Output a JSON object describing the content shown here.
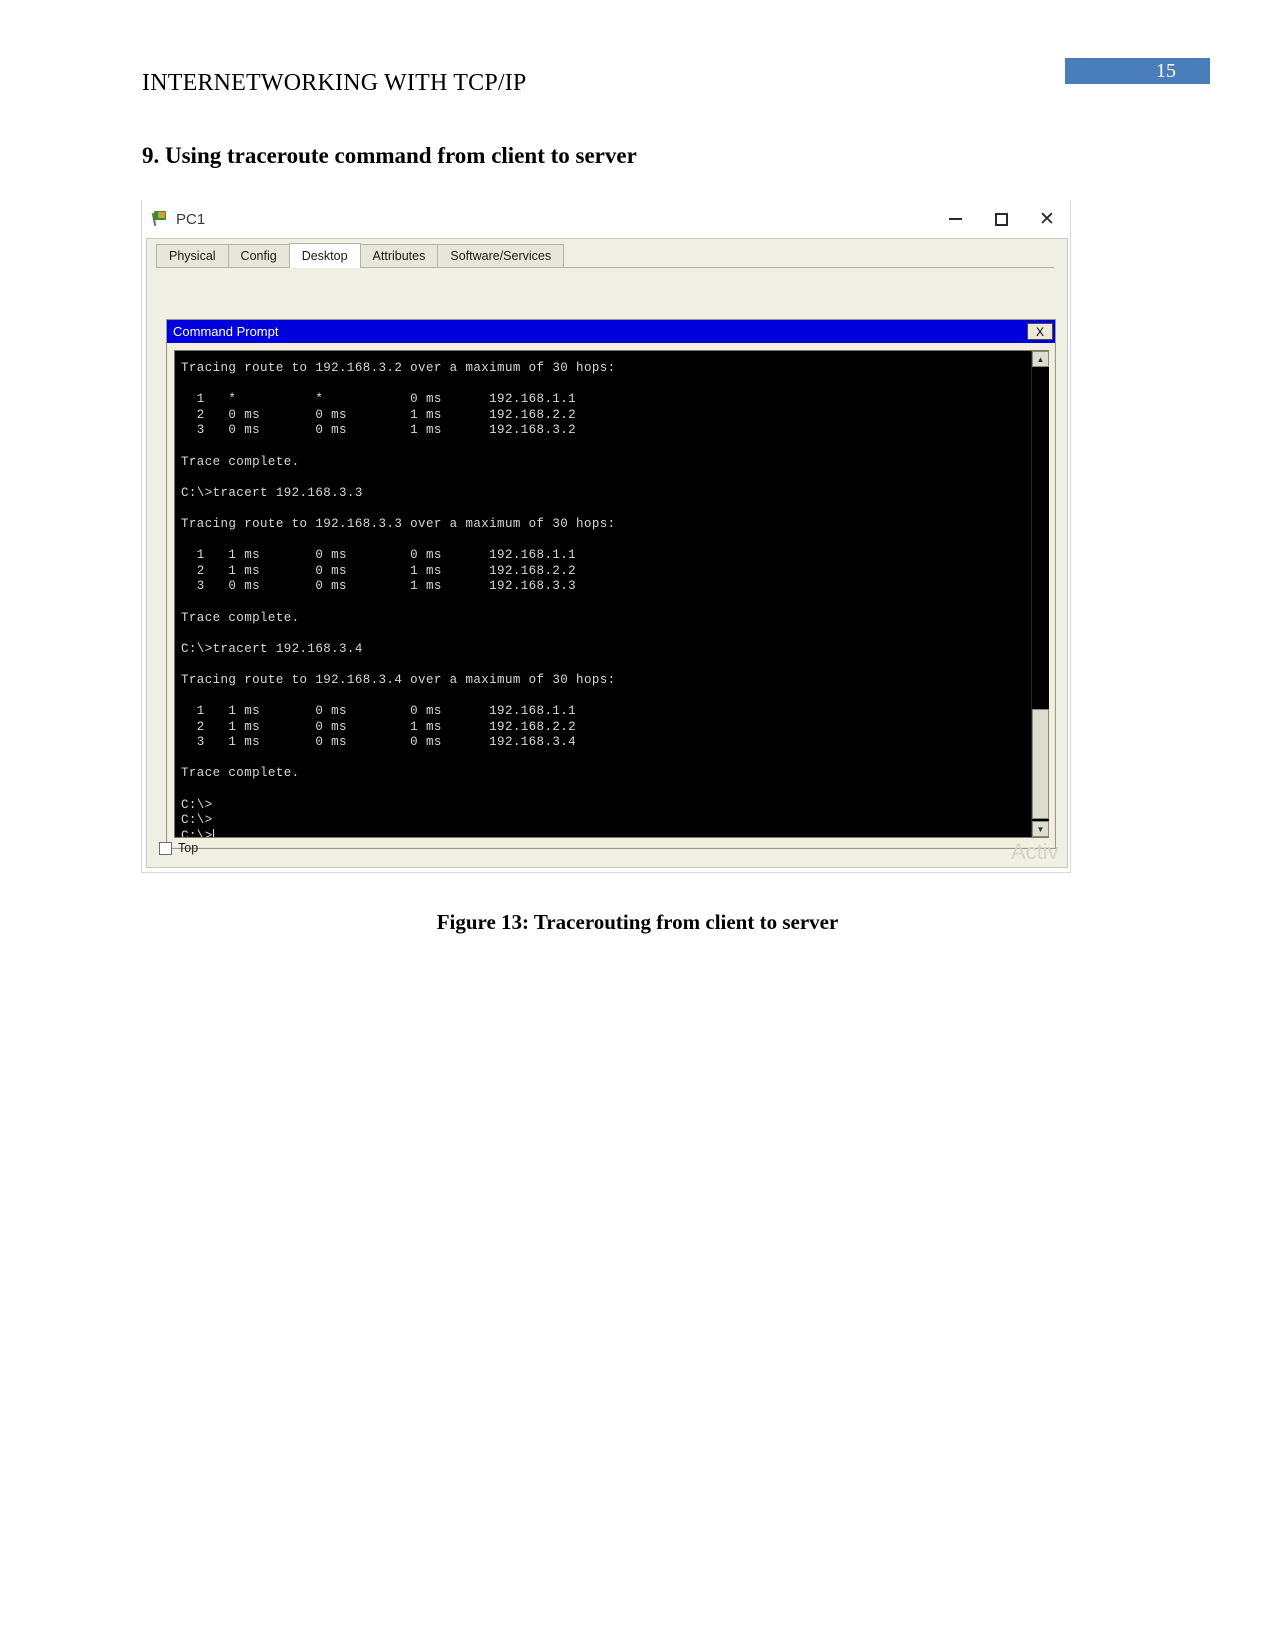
{
  "document": {
    "header_title": "INTERNETWORKING WITH TCP/IP",
    "page_number": "15",
    "section_title": "9. Using traceroute command from client to server",
    "figure_caption": "Figure 13: Tracerouting from client to server"
  },
  "pt_window": {
    "title": "PC1",
    "app_icon": "packet-tracer-flag-icon",
    "minimize_label": "—",
    "maximize_label": "□",
    "close_label": "✕",
    "tabs": [
      {
        "label": "Physical",
        "active": false
      },
      {
        "label": "Config",
        "active": false
      },
      {
        "label": "Desktop",
        "active": true
      },
      {
        "label": "Attributes",
        "active": false
      },
      {
        "label": "Software/Services",
        "active": false
      }
    ],
    "top_checkbox": {
      "label": "Top",
      "checked": false
    },
    "watermark": "Activ"
  },
  "command_prompt": {
    "title": "Command Prompt",
    "close_label": "X",
    "scrollbar": {
      "up_arrow": "▲",
      "down_arrow": "▼"
    },
    "lines": [
      "Tracing route to 192.168.3.2 over a maximum of 30 hops:",
      "",
      "  1   *          *           0 ms      192.168.1.1",
      "  2   0 ms       0 ms        1 ms      192.168.2.2",
      "  3   0 ms       0 ms        1 ms      192.168.3.2",
      "",
      "Trace complete.",
      "",
      "C:\\>tracert 192.168.3.3",
      "",
      "Tracing route to 192.168.3.3 over a maximum of 30 hops:",
      "",
      "  1   1 ms       0 ms        0 ms      192.168.1.1",
      "  2   1 ms       0 ms        1 ms      192.168.2.2",
      "  3   0 ms       0 ms        1 ms      192.168.3.3",
      "",
      "Trace complete.",
      "",
      "C:\\>tracert 192.168.3.4",
      "",
      "Tracing route to 192.168.3.4 over a maximum of 30 hops:",
      "",
      "  1   1 ms       0 ms        0 ms      192.168.1.1",
      "  2   1 ms       0 ms        1 ms      192.168.2.2",
      "  3   1 ms       0 ms        0 ms      192.168.3.4",
      "",
      "Trace complete.",
      "",
      "C:\\>",
      "C:\\>",
      "C:\\>"
    ]
  },
  "colors": {
    "page_badge": "#4a7ebb",
    "cmd_titlebar": "#0000dd",
    "terminal_bg": "#000000",
    "terminal_fg": "#d8d8d8"
  }
}
